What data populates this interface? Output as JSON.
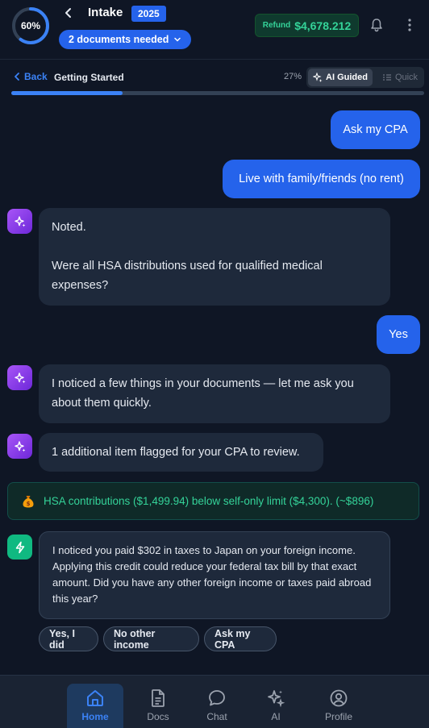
{
  "header": {
    "progress_pct": 60,
    "progress_label": "60%",
    "title": "Intake",
    "year": "2025",
    "docs_needed": "2 documents needed",
    "refund_label": "Refund",
    "refund_amount": "$4,678.212"
  },
  "subheader": {
    "back_label": "Back",
    "section": "Getting Started",
    "pct_label": "27%",
    "progress_fraction": 0.27,
    "mode_ai": "AI Guided",
    "mode_quick": "Quick"
  },
  "messages": {
    "user_1": "Ask my CPA",
    "user_2": "Live with family/friends (no rent)",
    "ai_1_line1": "Noted.",
    "ai_1_line2": "Were all HSA distributions used for qualified medical expenses?",
    "user_3": "Yes",
    "ai_2": "I noticed a few things in your documents — let me ask you about them quickly.",
    "ai_3": "1 additional item flagged for your CPA to review.",
    "flag": "HSA contributions ($1,499.94) below self-only limit ($4,300). (~$896)",
    "cpa": "I noticed you paid $302 in taxes to Japan on your foreign income. Applying this credit could reduce your federal tax bill by that exact amount. Did you have any other foreign income or taxes paid abroad this year?"
  },
  "chips": [
    "Yes, I did",
    "No other income",
    "Ask my CPA"
  ],
  "nav": {
    "home": "Home",
    "docs": "Docs",
    "chat": "Chat",
    "ai": "AI",
    "profile": "Profile"
  },
  "colors": {
    "accent": "#2563eb",
    "success": "#34d399",
    "ai_purple": "#8b5cf6",
    "background": "#0f1625"
  }
}
